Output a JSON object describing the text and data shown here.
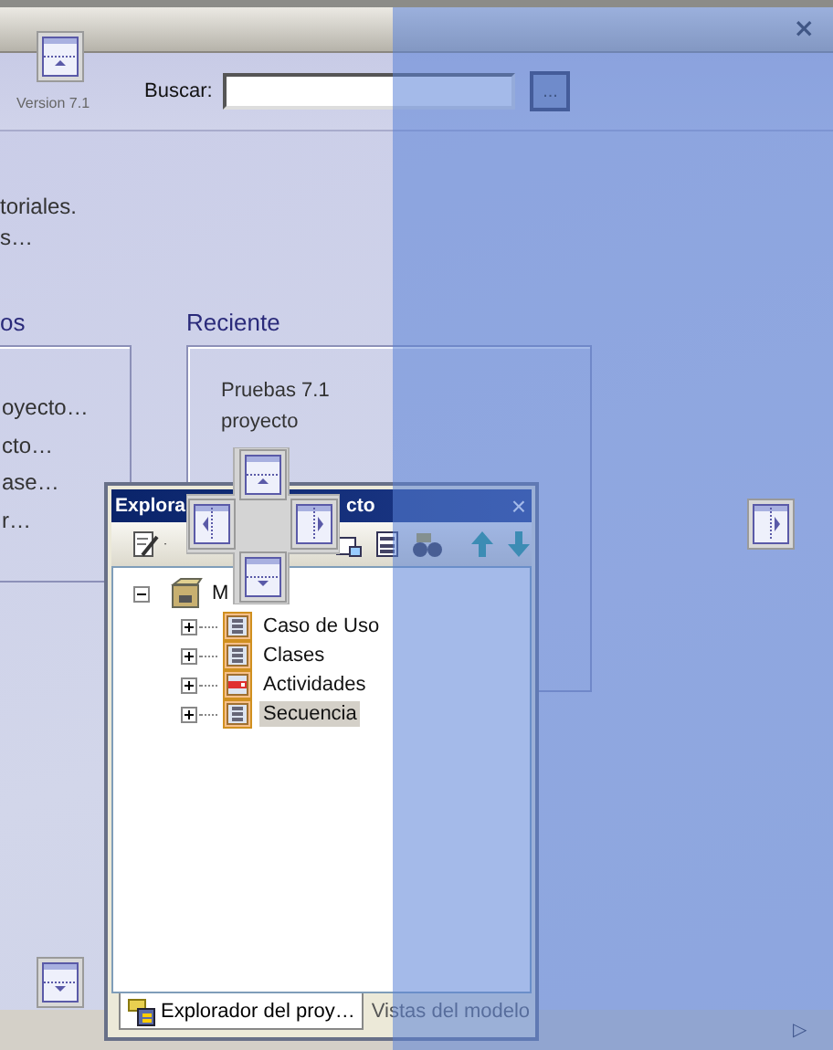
{
  "window": {
    "close": "×"
  },
  "header": {
    "version": "Version 7.1",
    "search_label": "Buscar:",
    "search_button": "..."
  },
  "intro": [
    "toriales.",
    "s…"
  ],
  "sections": [
    {
      "title": "os",
      "items": [
        "oyecto…",
        "cto…",
        "ase…",
        "r…"
      ]
    },
    {
      "title": "Reciente",
      "items": [
        "Pruebas 7.1",
        "proyecto"
      ]
    }
  ],
  "panel": {
    "title_parts": [
      "Explora",
      "cto"
    ],
    "close": "×",
    "tree": {
      "label": "M",
      "expanded": true,
      "selected": false,
      "children": [
        {
          "label": "Caso de Uso",
          "kind": "diagram",
          "expanded": false,
          "selected": false
        },
        {
          "label": "Clases",
          "kind": "diagram",
          "expanded": false,
          "selected": false
        },
        {
          "label": "Actividades",
          "kind": "activity",
          "expanded": false,
          "selected": false
        },
        {
          "label": "Secuencia",
          "kind": "diagram",
          "expanded": false,
          "selected": true
        }
      ]
    },
    "tabs": [
      {
        "label": "Explorador del proy…",
        "selected": true
      },
      {
        "label": "Vistas del modelo",
        "selected": false
      }
    ]
  },
  "status_bar": {
    "arrow": "▷"
  }
}
